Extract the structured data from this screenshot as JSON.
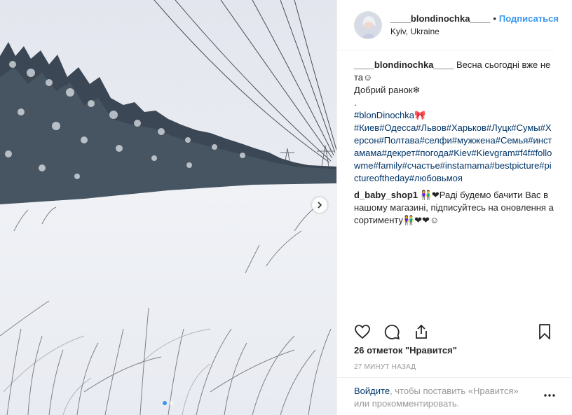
{
  "header": {
    "username": "____blondinochka____",
    "separator": "•",
    "follow_label": "Подписаться",
    "location": "Kyiv, Ukraine"
  },
  "caption": {
    "username": "____blondinochka____",
    "text_line1": "Весна сьогодні вже не та☺",
    "text_line2": "Добрий ранок❄",
    "text_line3": ".",
    "hashtags_line1": "#blonDinochka🎀",
    "hashtags_rest": "#Киев#Одесса#Львов#Харьков#Луцк#Сумы#Херсон#Полтава#селфи#мужжена#Семья#инстамама#декрет#погода#Kiev#Kievgram#f4f#followme#family#счастье#instamama#bestpicture#pictureoftheday#любовьмоя"
  },
  "comment": {
    "username": "d_baby_shop1",
    "text": "👫❤Раді будемо бачити Вас в нашому магазині, підписуйтесь на оновлення асортименту👫❤❤☺"
  },
  "likes_text": "26 отметок \"Нравится\"",
  "time_text": "27 МИНУТ НАЗАД",
  "login": {
    "link_label": "Войдите",
    "rest_text": ", чтобы поставить «Нравится» или прокомментировать."
  },
  "icons": {
    "like": "heart-icon",
    "comment": "comment-icon",
    "share": "share-icon",
    "save": "bookmark-icon",
    "more": "more-options-icon",
    "next": "chevron-right-icon"
  },
  "colors": {
    "link_blue": "#3897f0",
    "hashtag": "#003569",
    "muted": "#999999"
  }
}
